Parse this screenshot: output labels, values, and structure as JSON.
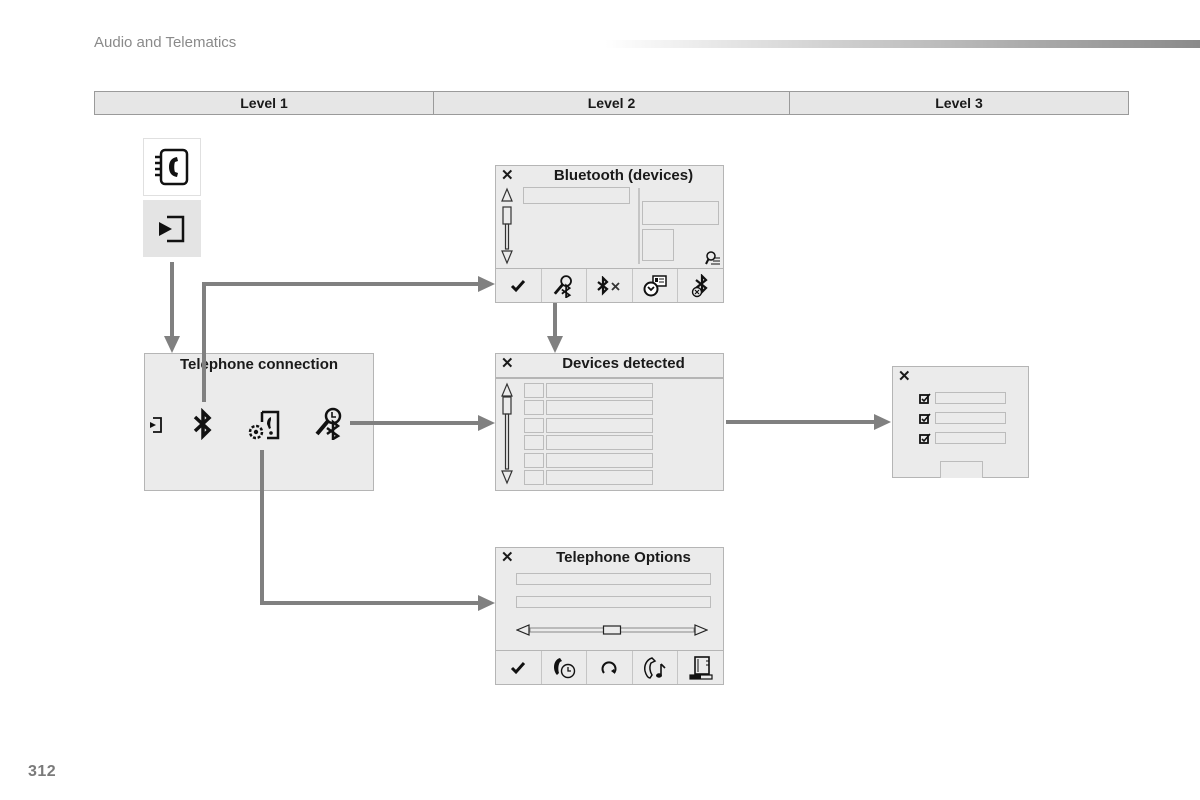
{
  "header": {
    "section_title": "Audio and Telematics"
  },
  "levels": [
    "Level 1",
    "Level 2",
    "Level 3"
  ],
  "level1": {
    "icons": [
      "phonebook-icon",
      "source-select-icon"
    ],
    "telephone_connection": {
      "title": "Telephone connection",
      "icons": [
        "source-back-icon",
        "bluetooth-icon",
        "phone-settings-icon",
        "bluetooth-search-icon"
      ]
    }
  },
  "level2": {
    "bluetooth_devices": {
      "close": "✕",
      "title": "Bluetooth (devices)",
      "toolbar": [
        "check-icon",
        "bluetooth-search-icon",
        "bluetooth-disconnect-icon",
        "device-profile-icon",
        "bluetooth-delete-icon"
      ],
      "detail_icon": "search-details-icon"
    },
    "devices_detected": {
      "close": "✕",
      "title": "Devices detected",
      "rows": 6
    },
    "telephone_options": {
      "close": "✕",
      "title": "Telephone Options",
      "slider_value": 0.5,
      "toolbar": [
        "check-icon",
        "call-log-icon",
        "refresh-icon",
        "ringtone-icon",
        "phonebook-export-icon"
      ]
    }
  },
  "level3": {
    "profiles_dialog": {
      "close": "✕",
      "checkbox_rows": 3
    }
  },
  "footer": {
    "page_number": "312"
  }
}
